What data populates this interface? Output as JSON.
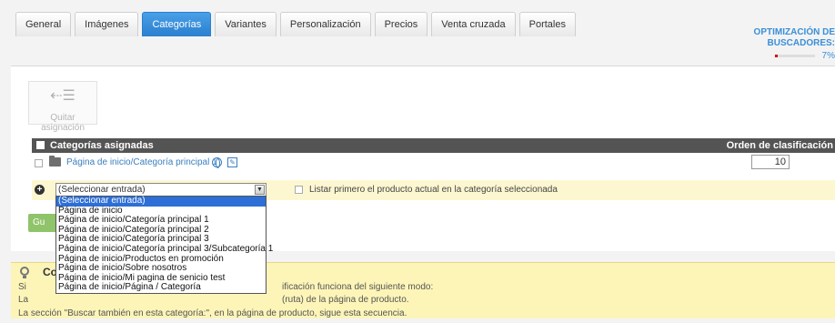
{
  "tabs": [
    {
      "label": "General",
      "active": false
    },
    {
      "label": "Imágenes",
      "active": false
    },
    {
      "label": "Categorías",
      "active": true
    },
    {
      "label": "Variantes",
      "active": false
    },
    {
      "label": "Personalización",
      "active": false
    },
    {
      "label": "Precios",
      "active": false
    },
    {
      "label": "Venta cruzada",
      "active": false
    },
    {
      "label": "Portales",
      "active": false
    }
  ],
  "seo": {
    "title_line1": "OPTIMIZACIÓN DE",
    "title_line2": "BUSCADORES:",
    "percent": "7%",
    "level": 0.07
  },
  "toolbar": {
    "remove_label": "Quitar asignación",
    "remove_icon": "unassign-icon"
  },
  "grid": {
    "header_title": "Categorías asignadas",
    "header_order": "Orden de clasificación",
    "rows": [
      {
        "path": "Página de inicio/Categoría principal 1",
        "order": "10"
      }
    ]
  },
  "add_row": {
    "select_value": "(Seleccionar entrada)",
    "first_label": "Listar primero el producto actual en la categoría seleccionada"
  },
  "dropdown_options": [
    "(Seleccionar entrada)",
    "Página de inicio",
    "Página de inicio/Categoría principal 1",
    "Página de inicio/Categoría principal 2",
    "Página de inicio/Categoría principal 3",
    "Página de inicio/Categoría principal 3/Subcategoría 1",
    "Página de inicio/Productos en promoción",
    "Página de inicio/Sobre nosotros",
    "Página de inicio/Mi pagina de senicio test",
    "Página de inicio/Página / Categoría"
  ],
  "save_label": "Gu",
  "info": {
    "title": "Co",
    "line1_start": "Si",
    "line1_end": "ificación funciona del siguiente modo:",
    "line2_start": "La",
    "line2_end": "(ruta) de la página de producto.",
    "line3": "La sección \"Buscar también en esta categoría:\", en la página de producto, sigue esta secuencia."
  },
  "colors": {
    "accent": "#2a7fcf",
    "header_bg": "#545454",
    "info_bg": "#fdf5b8",
    "add_row_bg": "#fdf7d1",
    "selected": "#2d6fd6"
  }
}
